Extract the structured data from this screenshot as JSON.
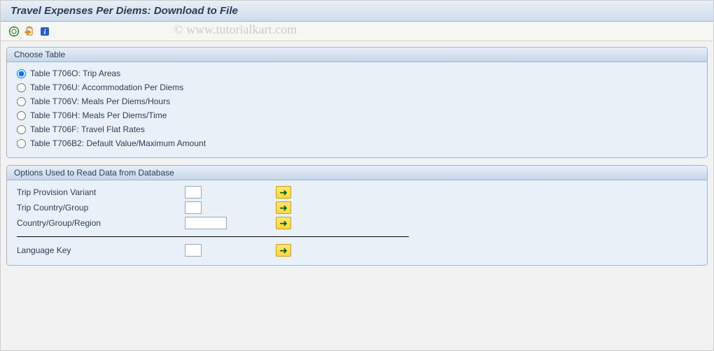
{
  "title": "Travel Expenses Per Diems: Download to File",
  "watermark": "© www.tutorialkart.com",
  "toolbar": {
    "execute_icon": "execute-icon",
    "variant_icon": "variant-icon",
    "info_icon": "info-icon"
  },
  "group_choose": {
    "title": "Choose Table",
    "options": [
      {
        "label": "Table T706O: Trip Areas",
        "selected": true
      },
      {
        "label": "Table T706U: Accommodation Per Diems",
        "selected": false
      },
      {
        "label": "Table T706V: Meals Per Diems/Hours",
        "selected": false
      },
      {
        "label": "Table T706H: Meals Per Diems/Time",
        "selected": false
      },
      {
        "label": "Table T706F: Travel Flat Rates",
        "selected": false
      },
      {
        "label": "Table T706B2: Default Value/Maximum Amount",
        "selected": false
      }
    ]
  },
  "group_options": {
    "title": "Options Used to Read Data from Database",
    "fields": {
      "trip_variant": {
        "label": "Trip Provision Variant",
        "value": ""
      },
      "trip_country": {
        "label": "Trip Country/Group",
        "value": ""
      },
      "cgr": {
        "label": "Country/Group/Region",
        "value": ""
      },
      "lang": {
        "label": "Language Key",
        "value": ""
      }
    }
  }
}
